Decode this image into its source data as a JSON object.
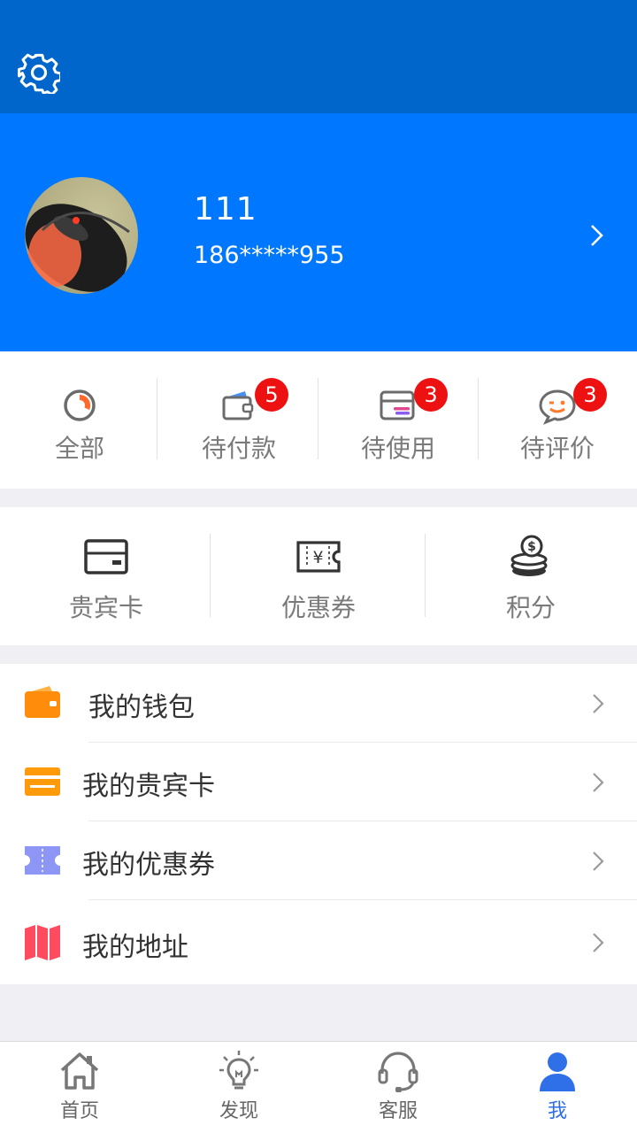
{
  "profile": {
    "username": "111",
    "phone": "186*****955"
  },
  "orders": [
    {
      "label": "全部",
      "icon": "pie-chart-icon",
      "badge": null
    },
    {
      "label": "待付款",
      "icon": "wallet-icon",
      "badge": "5"
    },
    {
      "label": "待使用",
      "icon": "box-icon",
      "badge": "3"
    },
    {
      "label": "待评价",
      "icon": "wink-chat-icon",
      "badge": "3"
    }
  ],
  "assets": [
    {
      "label": "贵宾卡",
      "icon": "card-icon"
    },
    {
      "label": "优惠券",
      "icon": "yen-ticket-icon"
    },
    {
      "label": "积分",
      "icon": "coins-icon"
    }
  ],
  "menu": [
    {
      "label": "我的钱包",
      "icon": "wallet-icon",
      "color": "#ff8c0a"
    },
    {
      "label": "我的贵宾卡",
      "icon": "card-icon",
      "color": "#ff9a0a"
    },
    {
      "label": "我的优惠券",
      "icon": "ticket-icon",
      "color": "#8d95f5"
    },
    {
      "label": "我的地址",
      "icon": "map-icon",
      "color": "#ff4b5f"
    }
  ],
  "tabs": [
    {
      "label": "首页",
      "icon": "home-icon"
    },
    {
      "label": "发现",
      "icon": "lightbulb-icon"
    },
    {
      "label": "客服",
      "icon": "headset-icon"
    },
    {
      "label": "我",
      "icon": "user-icon",
      "active": true
    }
  ],
  "colors": {
    "header_dark": "#0066cc",
    "header": "#0077ff",
    "badge": "#ee1111",
    "active_tab": "#2f6fe8"
  }
}
